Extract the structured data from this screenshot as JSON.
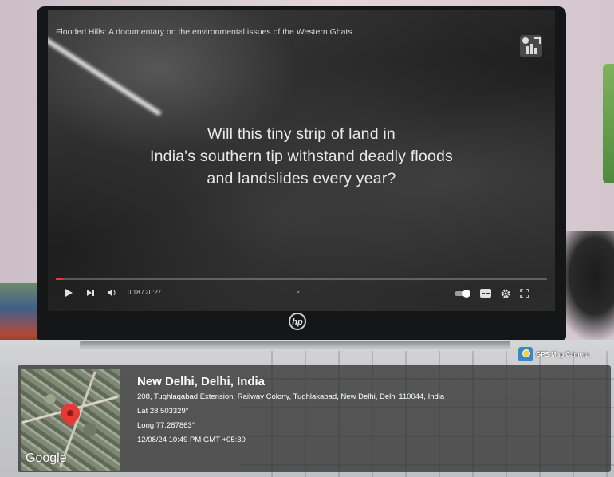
{
  "video": {
    "title": "Flooded Hills: A documentary on the environmental issues of the Western Ghats",
    "caption_lines": [
      "Will this tiny strip of land in",
      "India's southern tip withstand deadly floods",
      "and landslides every year?"
    ],
    "time": "0:18 / 20:27",
    "progress": 0.015,
    "laptop_brand": "hp"
  },
  "gps_overlay": {
    "badge_label": "GPS Map Camera",
    "map_label": "Google",
    "city": "New Delhi, Delhi, India",
    "address": "208, Tughlaqabad Extension, Railway Colony, Tughlakabad, New Delhi, Delhi 110044, India",
    "lat": "Lat 28.503329°",
    "long": "Long 77.287863°",
    "datetime": "12/08/24 10:49 PM GMT +05:30"
  },
  "icons": {
    "play": "play-icon",
    "next": "next-icon",
    "volume": "volume-icon",
    "chevron": "chevron-down-icon",
    "autoplay": "autoplay-toggle-icon",
    "subtitles": "subtitles-icon",
    "settings": "gear-icon",
    "fullscreen": "fullscreen-icon",
    "pin": "map-pin-icon"
  },
  "colors": {
    "progress": "#e53935",
    "pin": "#e53935"
  }
}
